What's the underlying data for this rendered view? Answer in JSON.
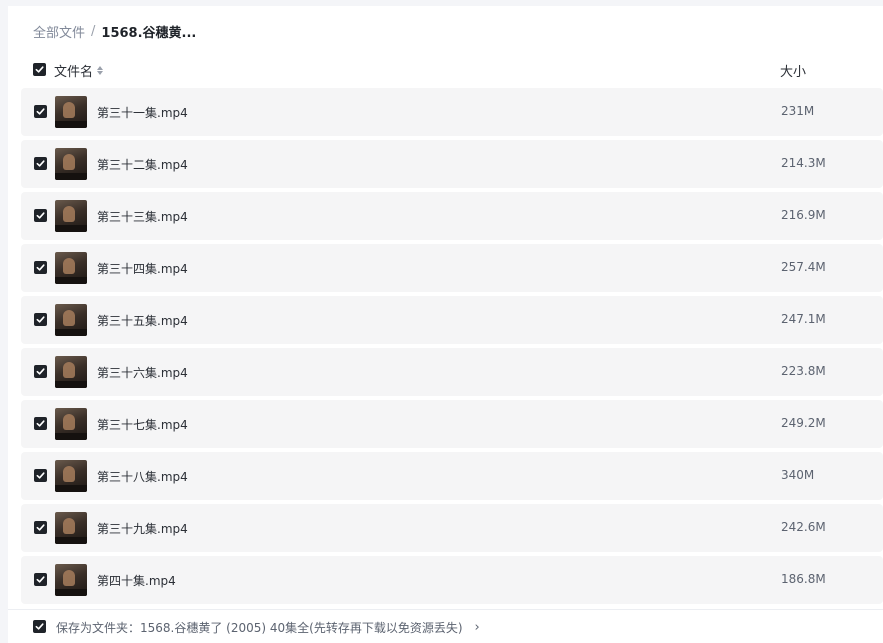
{
  "breadcrumb": {
    "root": "全部文件",
    "separator": "/",
    "current": "1568.谷穗黄..."
  },
  "table_header": {
    "name_label": "文件名",
    "size_label": "大小"
  },
  "files": [
    {
      "name": "第三十一集.mp4",
      "size": "231M",
      "checked": true
    },
    {
      "name": "第三十二集.mp4",
      "size": "214.3M",
      "checked": true
    },
    {
      "name": "第三十三集.mp4",
      "size": "216.9M",
      "checked": true
    },
    {
      "name": "第三十四集.mp4",
      "size": "257.4M",
      "checked": true
    },
    {
      "name": "第三十五集.mp4",
      "size": "247.1M",
      "checked": true
    },
    {
      "name": "第三十六集.mp4",
      "size": "223.8M",
      "checked": true
    },
    {
      "name": "第三十七集.mp4",
      "size": "249.2M",
      "checked": true
    },
    {
      "name": "第三十八集.mp4",
      "size": "340M",
      "checked": true
    },
    {
      "name": "第三十九集.mp4",
      "size": "242.6M",
      "checked": true
    },
    {
      "name": "第四十集.mp4",
      "size": "186.8M",
      "checked": true
    }
  ],
  "footer": {
    "save_label": "保存为文件夹：1568.谷穗黄了 (2005) 40集全(先转存再下载以免资源丢失)",
    "chevron": "›",
    "checked": true
  },
  "icons": {
    "checkbox": "checkbox-checked-icon",
    "sort": "sort-icon",
    "chevron": "chevron-right-icon",
    "thumbnail": "video-thumbnail"
  },
  "colors": {
    "checkbox": "#1f2329",
    "row_background": "#f5f5f6",
    "muted_text": "#818999"
  }
}
